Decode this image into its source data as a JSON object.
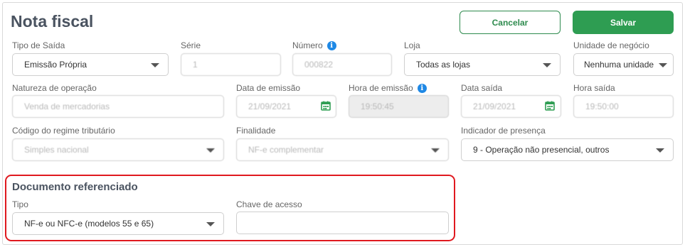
{
  "page": {
    "title": "Nota fiscal"
  },
  "actions": {
    "cancel_label": "Cancelar",
    "save_label": "Salvar"
  },
  "row1": {
    "tipo_saida": {
      "label": "Tipo de Saída",
      "value": "Emissão Própria"
    },
    "serie": {
      "label": "Série",
      "value": "1"
    },
    "numero": {
      "label": "Número",
      "value": "000822"
    },
    "loja": {
      "label": "Loja",
      "value": "Todas as lojas"
    },
    "unidade": {
      "label": "Unidade de negócio",
      "value": "Nenhuma unidade"
    }
  },
  "row2": {
    "natureza": {
      "label": "Natureza de operação",
      "value": "Venda de mercadorias"
    },
    "data_emissao": {
      "label": "Data de emissão",
      "value": "21/09/2021"
    },
    "hora_emissao": {
      "label": "Hora de emissão",
      "value": "19:50:45"
    },
    "data_saida": {
      "label": "Data saída",
      "value": "21/09/2021"
    },
    "hora_saida": {
      "label": "Hora saída",
      "value": "19:50:00"
    }
  },
  "row3": {
    "regime": {
      "label": "Código do regime tributário",
      "value": "Simples nacional"
    },
    "finalidade": {
      "label": "Finalidade",
      "value": "NF-e complementar"
    },
    "presenca": {
      "label": "Indicador de presença",
      "value": "9 - Operação não presencial, outros"
    }
  },
  "referenciado": {
    "title": "Documento referenciado",
    "tipo": {
      "label": "Tipo",
      "value": "NF-e ou NFC-e (modelos 55 e 65)"
    },
    "chave": {
      "label": "Chave de acesso",
      "value": ""
    }
  },
  "icons": {
    "info": "i"
  },
  "colors": {
    "primary_green": "#2e9d52",
    "highlight_red": "#e0191f",
    "info_blue": "#1e88e5"
  }
}
